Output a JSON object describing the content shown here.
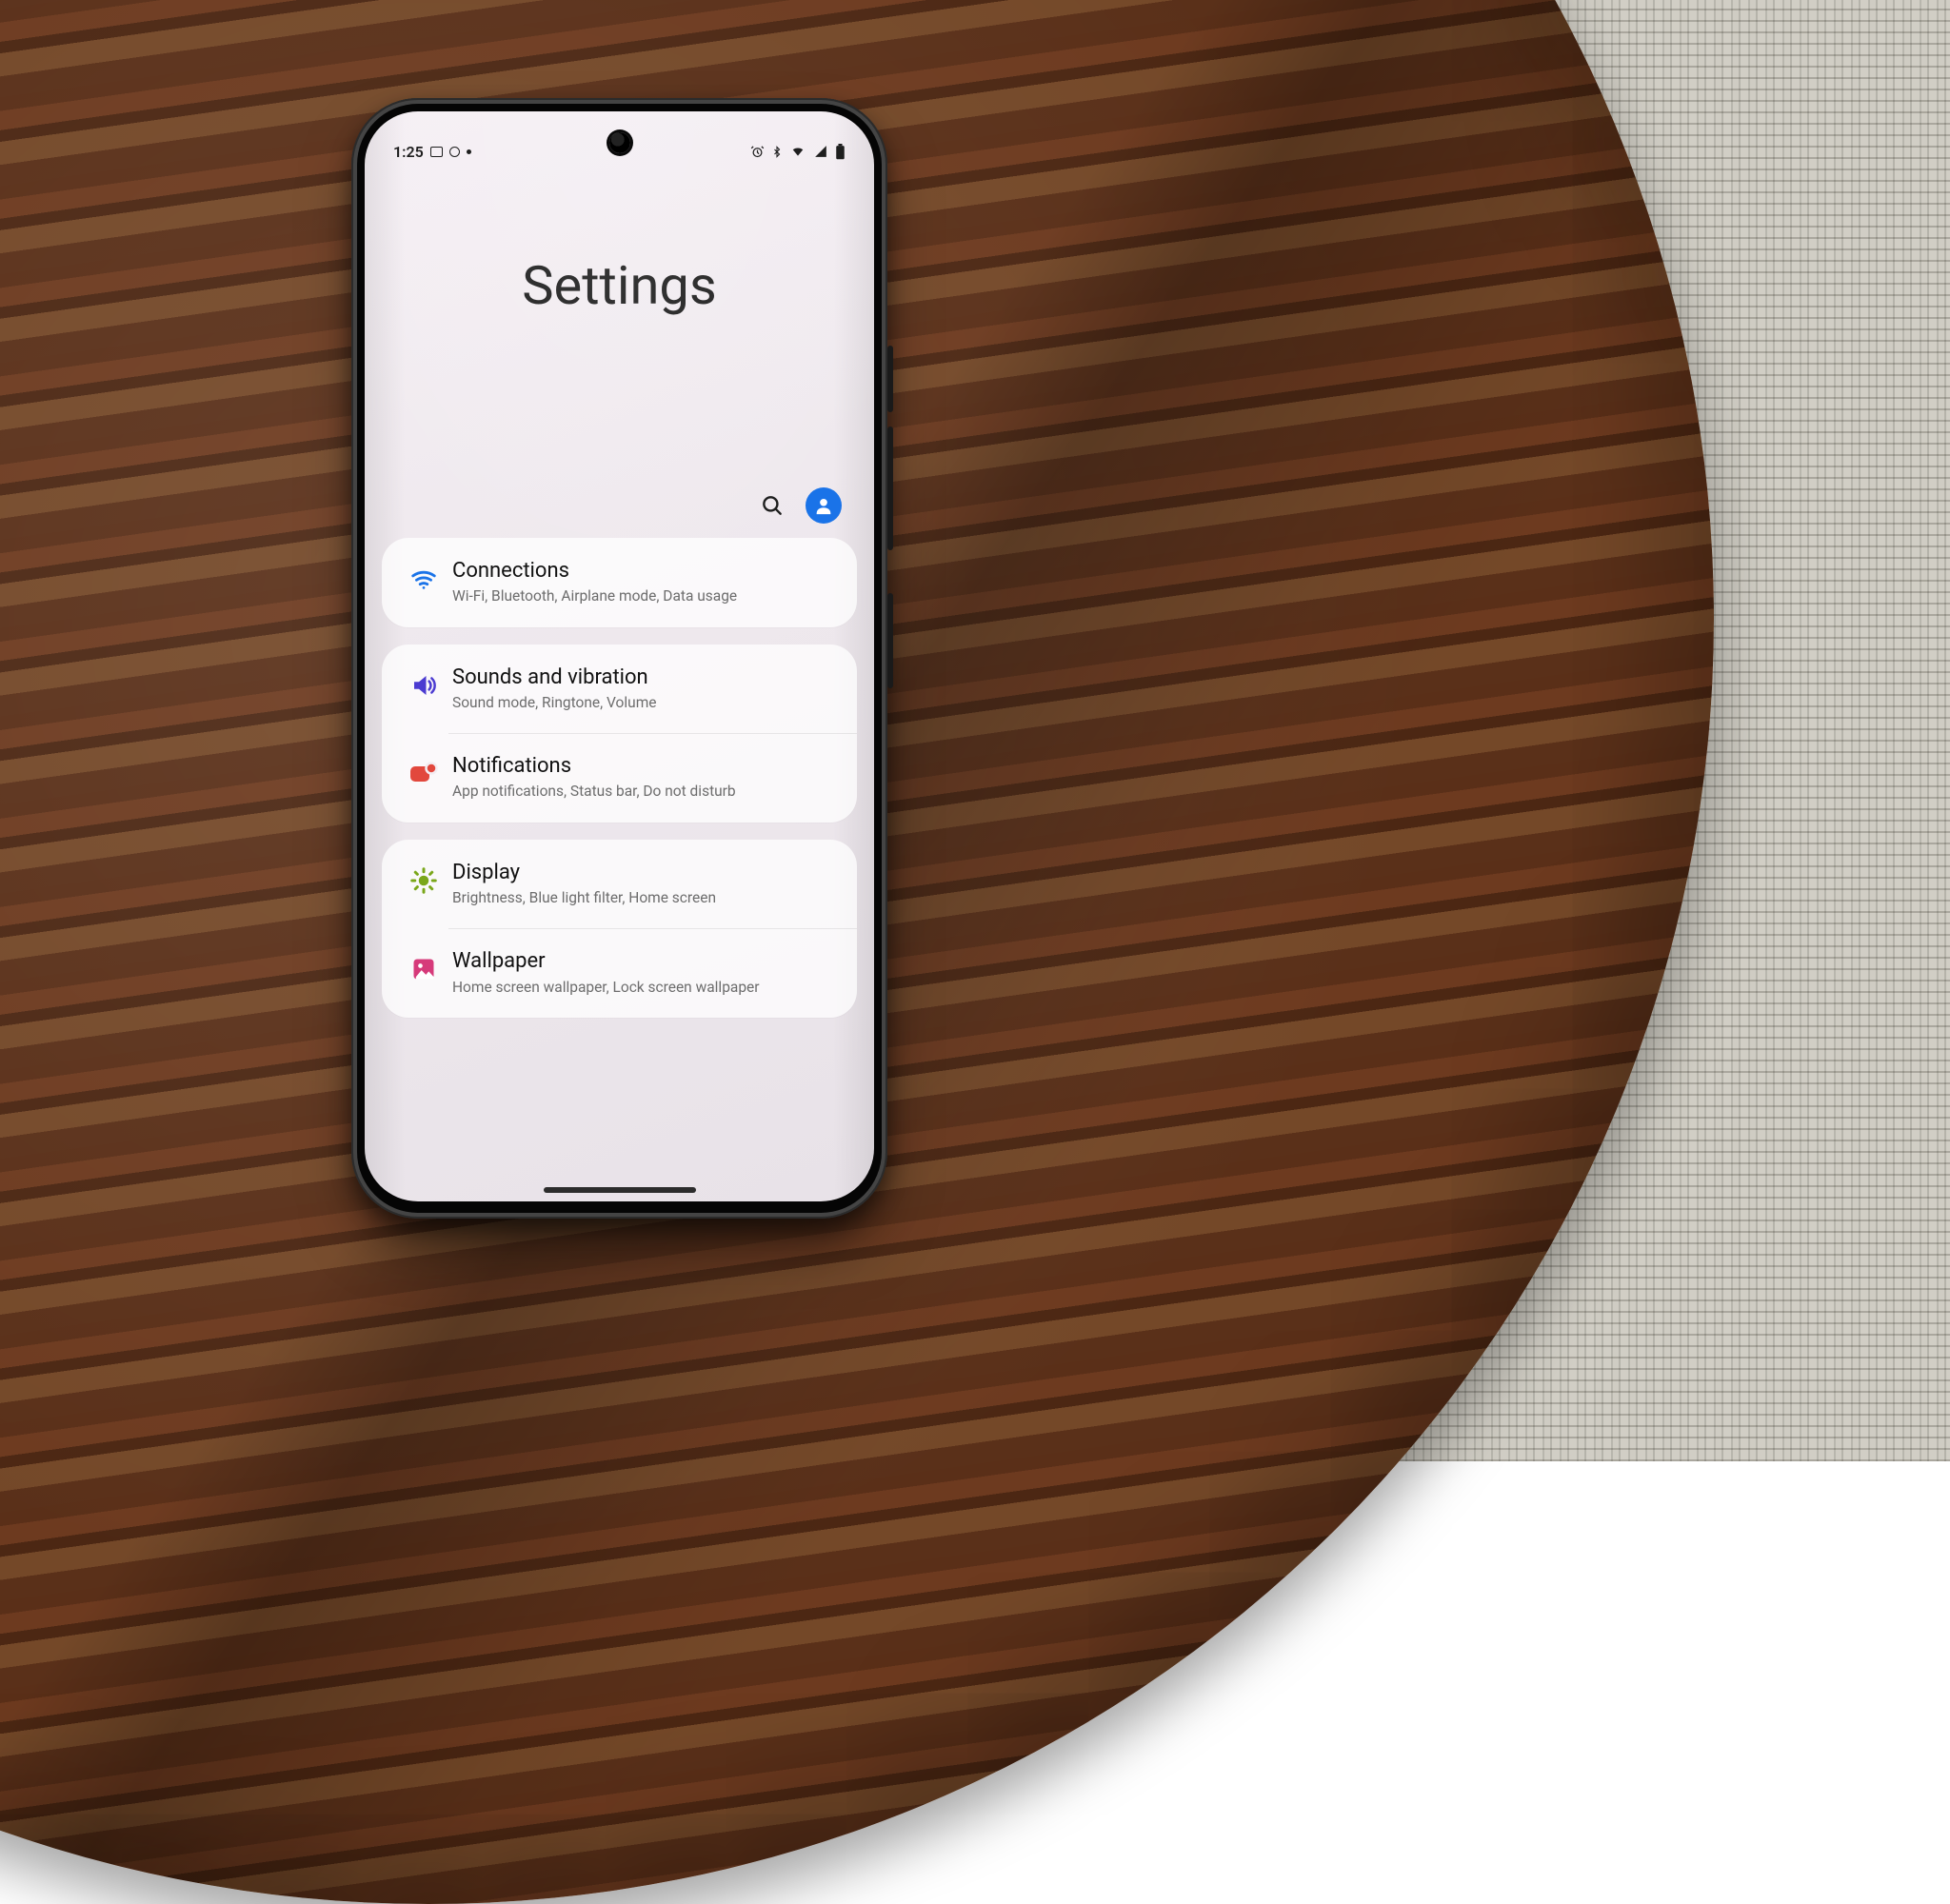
{
  "statusbar": {
    "time": "1:25"
  },
  "header": {
    "title": "Settings",
    "search_label": "Search settings",
    "account_label": "Samsung account"
  },
  "groups": [
    {
      "items": [
        {
          "key": "connections",
          "title": "Connections",
          "subtitle": "Wi-Fi, Bluetooth, Airplane mode, Data usage",
          "icon": "wifi",
          "icon_color": "#1a73e8"
        }
      ]
    },
    {
      "items": [
        {
          "key": "sounds",
          "title": "Sounds and vibration",
          "subtitle": "Sound mode, Ringtone, Volume",
          "icon": "volume",
          "icon_color": "#4b3bd1"
        },
        {
          "key": "notifications",
          "title": "Notifications",
          "subtitle": "App notifications, Status bar, Do not disturb",
          "icon": "notification",
          "icon_color": "#e2483d"
        }
      ]
    },
    {
      "items": [
        {
          "key": "display",
          "title": "Display",
          "subtitle": "Brightness, Blue light filter, Home screen",
          "icon": "brightness",
          "icon_color": "#7aa71a"
        },
        {
          "key": "wallpaper",
          "title": "Wallpaper",
          "subtitle": "Home screen wallpaper, Lock screen wallpaper",
          "icon": "wallpaper",
          "icon_color": "#d63a7a"
        }
      ]
    }
  ]
}
